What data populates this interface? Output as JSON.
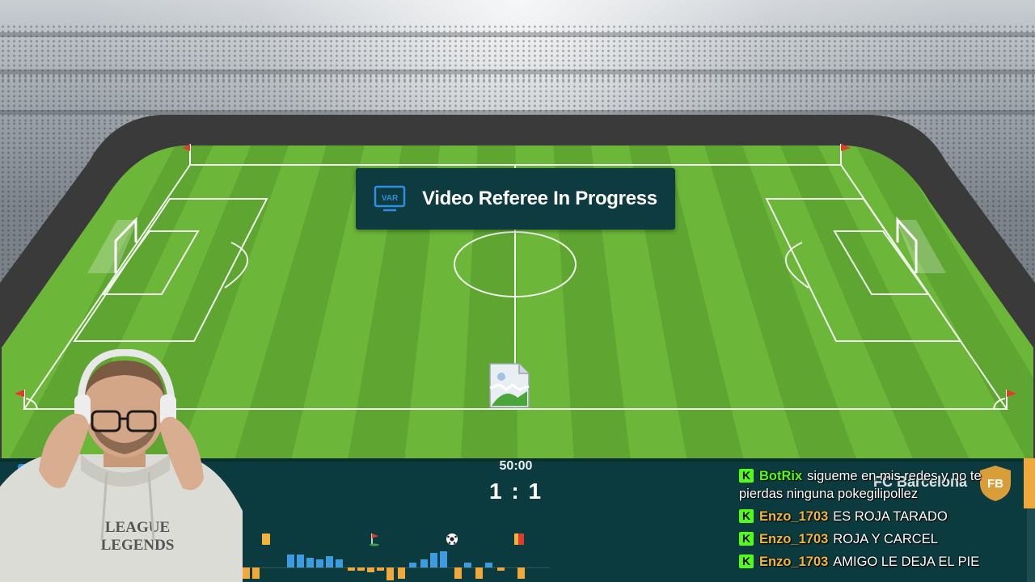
{
  "var_banner": {
    "icon": "var-monitor-icon",
    "icon_text": "VAR",
    "text": "Video Referee In Progress"
  },
  "scoreboard": {
    "time": "50:00",
    "score": "1 : 1",
    "away_team": "FC Barcelona",
    "away_badge_text": "FB",
    "timeline_events": [
      "yellow-card-icon",
      "corner-flag-icon",
      "goal-ball-icon",
      "yellow-red-card-icon"
    ]
  },
  "chat": {
    "messages": [
      {
        "badge": "K",
        "user": "BotRix",
        "user_color": "#53fc18",
        "text": "sigueme en mis redes y no te pierdas ninguna pokegilipollez"
      },
      {
        "badge": "K",
        "user": "Enzo_1703",
        "user_color": "#f2b43a",
        "text": "ES ROJA TARADO"
      },
      {
        "badge": "K",
        "user": "Enzo_1703",
        "user_color": "#f2b43a",
        "text": "ROJA Y CARCEL"
      },
      {
        "badge": "K",
        "user": "Enzo_1703",
        "user_color": "#f2b43a",
        "text": "AMIGO LE DEJA EL PIE"
      }
    ]
  },
  "colors": {
    "pitch_light": "#6cb63a",
    "pitch_dark": "#5ea532",
    "scoreboard_bg": "#0c3b3f",
    "home_blue": "#2b8fd6",
    "away_orange": "#f0a93a"
  }
}
